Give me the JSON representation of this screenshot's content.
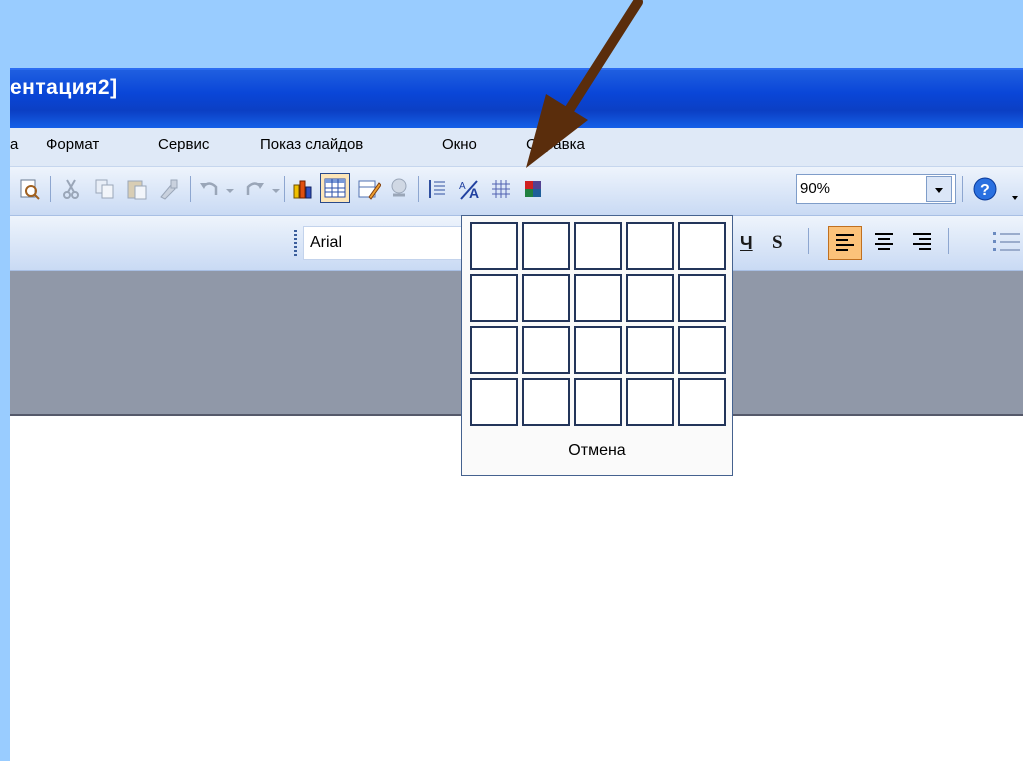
{
  "window": {
    "title": "ентация2]"
  },
  "menu": {
    "items": [
      {
        "label": "а"
      },
      {
        "label": "Формат"
      },
      {
        "label": "Сервис"
      },
      {
        "label": "Показ слайдов"
      },
      {
        "label": "Окно"
      },
      {
        "label": "Справка"
      }
    ]
  },
  "toolbar": {
    "zoom_value": "90%"
  },
  "format_toolbar": {
    "font_name": "Arial",
    "underline_glyph": "Ч",
    "shadow_glyph": "S"
  },
  "table_dropdown": {
    "rows": 4,
    "cols": 5,
    "cancel_label": "Отмена"
  },
  "colors": {
    "title_bar": "#0b3fc4",
    "background": "#99ccff",
    "arrow": "#5a2d0c",
    "workspace": "#9098a8",
    "selected_align": "#fbc27a"
  },
  "icons": [
    "print-preview-icon",
    "cut-icon",
    "copy-icon",
    "paste-icon",
    "format-painter-icon",
    "undo-icon",
    "redo-icon",
    "chart-icon",
    "table-icon",
    "tables-borders-icon",
    "hyperlink-icon",
    "expand-icon",
    "show-formatting-icon",
    "grid-icon",
    "color-icon",
    "help-icon",
    "align-left-icon",
    "align-center-icon",
    "align-right-icon",
    "numbering-icon"
  ]
}
